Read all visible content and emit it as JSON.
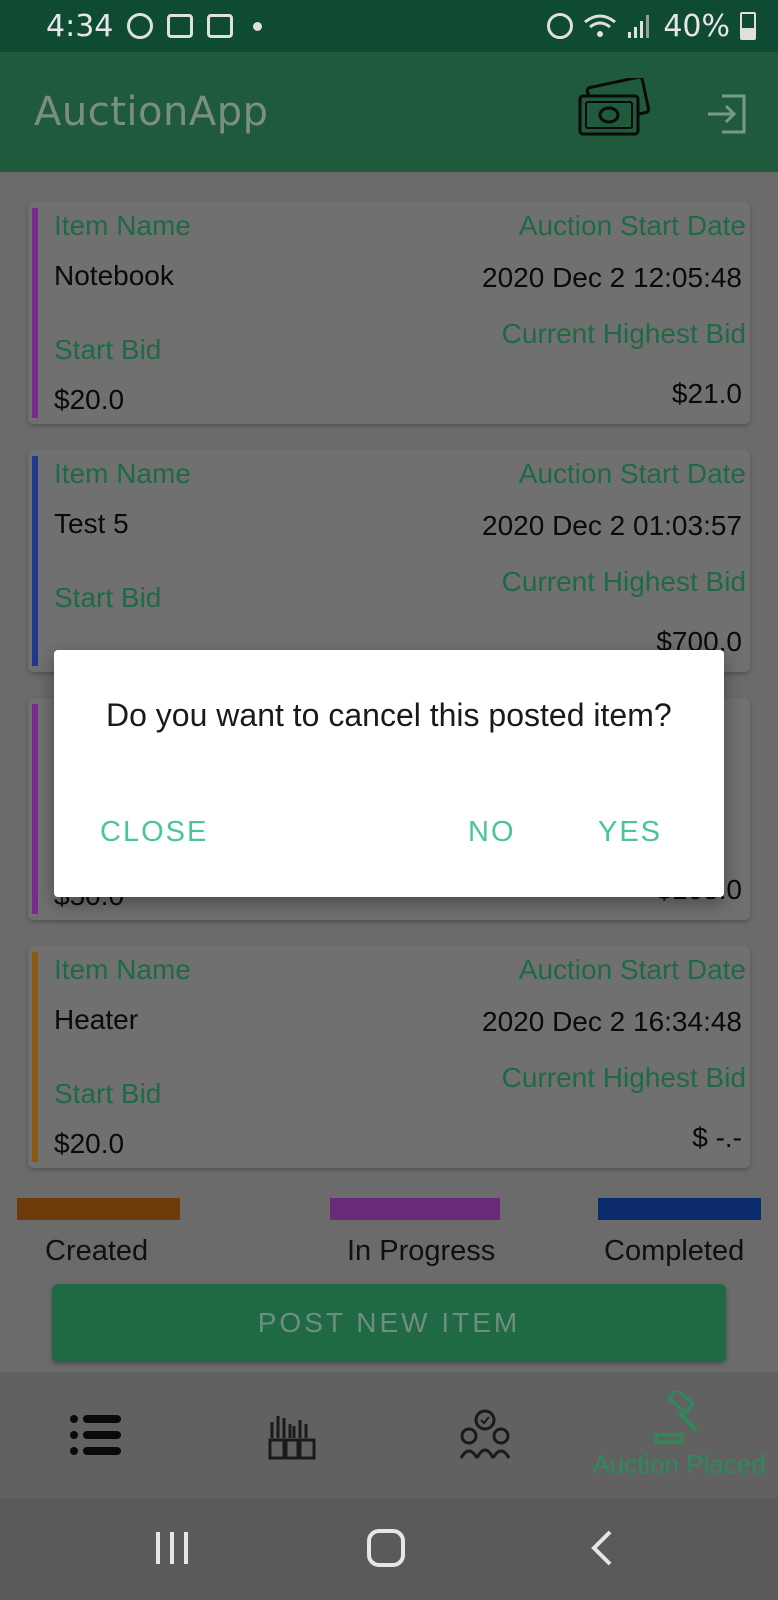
{
  "status_bar": {
    "time": "4:34",
    "battery": "40%"
  },
  "app_bar": {
    "title": "AuctionApp"
  },
  "cards": [
    {
      "accent": "#7a2a8c",
      "item_name_label": "Item Name",
      "item_name": "Notebook",
      "start_date_label": "Auction Start Date",
      "start_date": "2020 Dec 2 12:05:48",
      "start_bid_label": "Start Bid",
      "start_bid": "$20.0",
      "highest_bid_label": "Current Highest Bid",
      "highest_bid": "$21.0"
    },
    {
      "accent": "#1e3a8a",
      "item_name_label": "Item Name",
      "item_name": "Test 5",
      "start_date_label": "Auction Start Date",
      "start_date": "2020 Dec 2 01:03:57",
      "start_bid_label": "Start Bid",
      "start_bid": "",
      "highest_bid_label": "Current Highest Bid",
      "highest_bid": "$700.0"
    },
    {
      "accent": "#7a2a8c",
      "start_bid": "$50.0",
      "highest_bid": "$105.0"
    },
    {
      "accent": "#8a5a12",
      "item_name_label": "Item Name",
      "item_name": "Heater",
      "start_date_label": "Auction Start Date",
      "start_date": "2020 Dec 2 16:34:48",
      "start_bid_label": "Start Bid",
      "start_bid": "$20.0",
      "highest_bid_label": "Current Highest Bid",
      "highest_bid": "$ -.-"
    }
  ],
  "legend": {
    "created": {
      "label": "Created",
      "color": "#6e3a0a"
    },
    "in_progress": {
      "label": "In Progress",
      "color": "#6a2a7a"
    },
    "completed": {
      "label": "Completed",
      "color": "#0c2a6e"
    }
  },
  "post_button": {
    "label": "POST NEW ITEM"
  },
  "bottom_nav": {
    "items": [
      {
        "icon": "list-icon",
        "label": ""
      },
      {
        "icon": "raised-hands-icon",
        "label": ""
      },
      {
        "icon": "bidders-icon",
        "label": ""
      },
      {
        "icon": "gavel-icon",
        "label": "Auction Placed"
      }
    ]
  },
  "dialog": {
    "message": "Do you want to cancel this posted item?",
    "close_label": "CLOSE",
    "no_label": "NO",
    "yes_label": "YES"
  }
}
